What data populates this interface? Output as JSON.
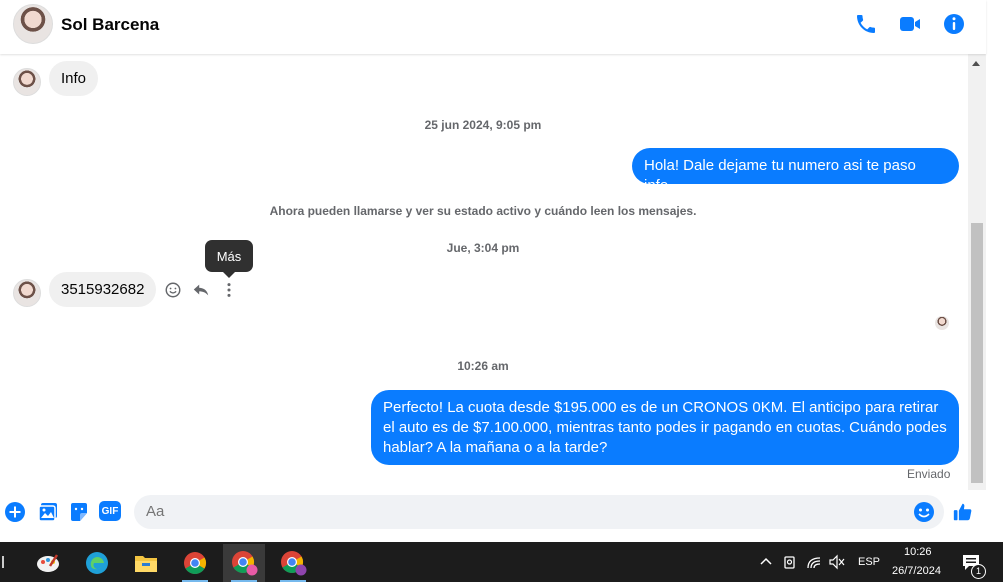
{
  "header": {
    "contact_name": "Sol Barcena",
    "icons": [
      "phone-icon",
      "video-camera-icon",
      "info-icon"
    ]
  },
  "messages": {
    "info_bubble": "Info",
    "timestamp_1": "25 jun 2024, 9:05 pm",
    "outgoing_1": "Hola! Dale dejame tu numero asi te paso info.",
    "system_notice": "Ahora pueden llamarse y ver su estado activo y cuándo leen los mensajes.",
    "timestamp_2": "Jue, 3:04 pm",
    "incoming_number": "3515932682",
    "tooltip": "Más",
    "timestamp_3": "10:26 am",
    "outgoing_2": "Perfecto! La cuota desde $195.000 es de un CRONOS 0KM. El anticipo para retirar el auto es de $7.100.000, mientras tanto podes ir pagando en cuotas. Cuándo podes hablar? A la mañana o a la tarde?",
    "sent_status": "Enviado"
  },
  "composer": {
    "placeholder": "Aa",
    "gif_label": "GIF"
  },
  "taskbar": {
    "language": "ESP",
    "time": "10:26",
    "date": "26/7/2024",
    "notification_count": "1"
  },
  "colors": {
    "accent": "#0a7cff",
    "incoming_bubble": "#f0f0f0",
    "taskbar": "#1c1c1c"
  }
}
